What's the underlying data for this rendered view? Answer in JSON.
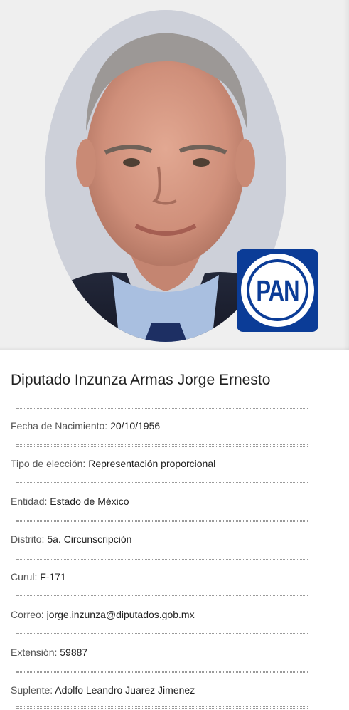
{
  "party": {
    "abbreviation": "PAN",
    "colors": {
      "primary": "#0b3c97",
      "secondary": "#ffffff"
    }
  },
  "photo": {
    "subject": "portrait-photo"
  },
  "deputy": {
    "name": "Diputado Inzunza Armas Jorge Ernesto",
    "fields": [
      {
        "label": "Fecha de Nacimiento:",
        "value": "20/10/1956"
      },
      {
        "label": "Tipo de elección:",
        "value": "Representación proporcional"
      },
      {
        "label": "Entidad:",
        "value": "Estado de México"
      },
      {
        "label": "Distrito:",
        "value": "5a. Circunscripción"
      },
      {
        "label": "Curul:",
        "value": "F-171"
      },
      {
        "label": "Correo:",
        "value": "jorge.inzunza@diputados.gob.mx"
      },
      {
        "label": "Extensión:",
        "value": "59887"
      },
      {
        "label": "Suplente:",
        "value": "Adolfo Leandro Juarez Jimenez"
      }
    ]
  }
}
